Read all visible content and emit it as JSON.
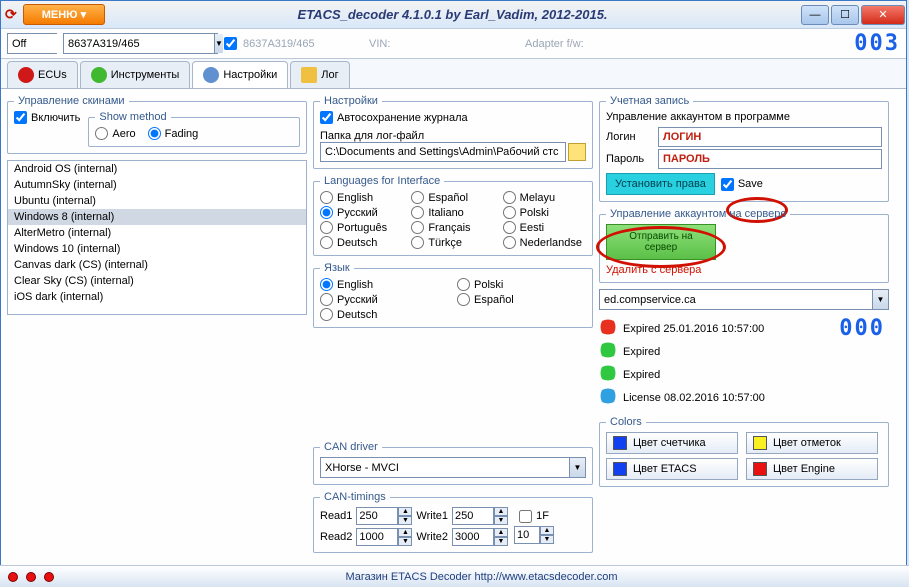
{
  "titlebar": {
    "menu": "МЕНЮ ▾",
    "title": "ETACS_decoder 4.1.0.1 by Earl_Vadim, 2012-2015."
  },
  "toolbar": {
    "off": "Off",
    "partnum": "8637A319/465",
    "partnum_disabled": "8637A319/465",
    "vin_label": "VIN:",
    "adapter_label": "Adapter f/w:",
    "counter": "003"
  },
  "tabs": {
    "ecus": "ECUs",
    "instruments": "Инструменты",
    "settings": "Настройки",
    "log": "Лог"
  },
  "skins": {
    "legend": "Управление скинами",
    "enable": "Включить",
    "show_legend": "Show method",
    "aero": "Aero",
    "fading": "Fading",
    "items": [
      "Android OS (internal)",
      "AutumnSky (internal)",
      "Ubuntu (internal)",
      "Windows 8 (internal)",
      "AlterMetro (internal)",
      "Windows 10 (internal)",
      "Canvas dark (CS) (internal)",
      "Clear Sky (CS) (internal)",
      "iOS dark (internal)"
    ],
    "selected_index": 3
  },
  "settings_fs": {
    "legend": "Настройки",
    "autosave": "Автосохранение журнала",
    "folder_label": "Папка для лог-файл",
    "folder_path": "C:\\Documents and Settings\\Admin\\Рабочий стс"
  },
  "langs_iface": {
    "legend": "Languages for Interface",
    "opts": [
      "English",
      "Español",
      "Melayu",
      "Русский",
      "Italiano",
      "Polski",
      "Português",
      "Français",
      "Eesti",
      "Deutsch",
      "Türkçe",
      "Nederlandse"
    ],
    "selected": "Русский"
  },
  "lang": {
    "legend": "Язык",
    "opts": [
      "English",
      "Polski",
      "Русский",
      "Español",
      "Deutsch"
    ],
    "selected": "English"
  },
  "can": {
    "legend": "CAN driver",
    "driver": "XHorse - MVCI"
  },
  "can_timings": {
    "legend": "CAN-timings",
    "read1_l": "Read1",
    "read1_v": "250",
    "write1_l": "Write1",
    "write1_v": "250",
    "read2_l": "Read2",
    "read2_v": "1000",
    "write2_l": "Write2",
    "write2_v": "3000",
    "onef": "1F",
    "ten": "10"
  },
  "account": {
    "legend": "Учетная запись",
    "sub": "Управление аккаунтом в программе",
    "login_l": "Логин",
    "login_v": "ЛОГИН",
    "pass_l": "Пароль",
    "pass_v": "ПАРОЛЬ",
    "set_rights": "Установить права",
    "save": "Save"
  },
  "server": {
    "legend": "Управление аккаунтом на сервере",
    "send": "Отправить на сервер",
    "delete": "Удалить с сервера",
    "host": "ed.compservice.ca"
  },
  "licenses": [
    {
      "txt": "Expired 25.01.2016 10:57:00",
      "color": "#e83020"
    },
    {
      "txt": "Expired",
      "color": "#30c840"
    },
    {
      "txt": "Expired",
      "color": "#30c840"
    },
    {
      "txt": "License 08.02.2016 10:57:00",
      "color": "#30a0e0"
    }
  ],
  "license_counter": "000",
  "colors": {
    "legend": "Colors",
    "counter": "Цвет счетчика",
    "marks": "Цвет отметок",
    "etacs": "Цвет ETACS",
    "engine": "Цвет Engine"
  },
  "status": {
    "url": "Магазин ETACS Decoder http://www.etacsdecoder.com"
  }
}
